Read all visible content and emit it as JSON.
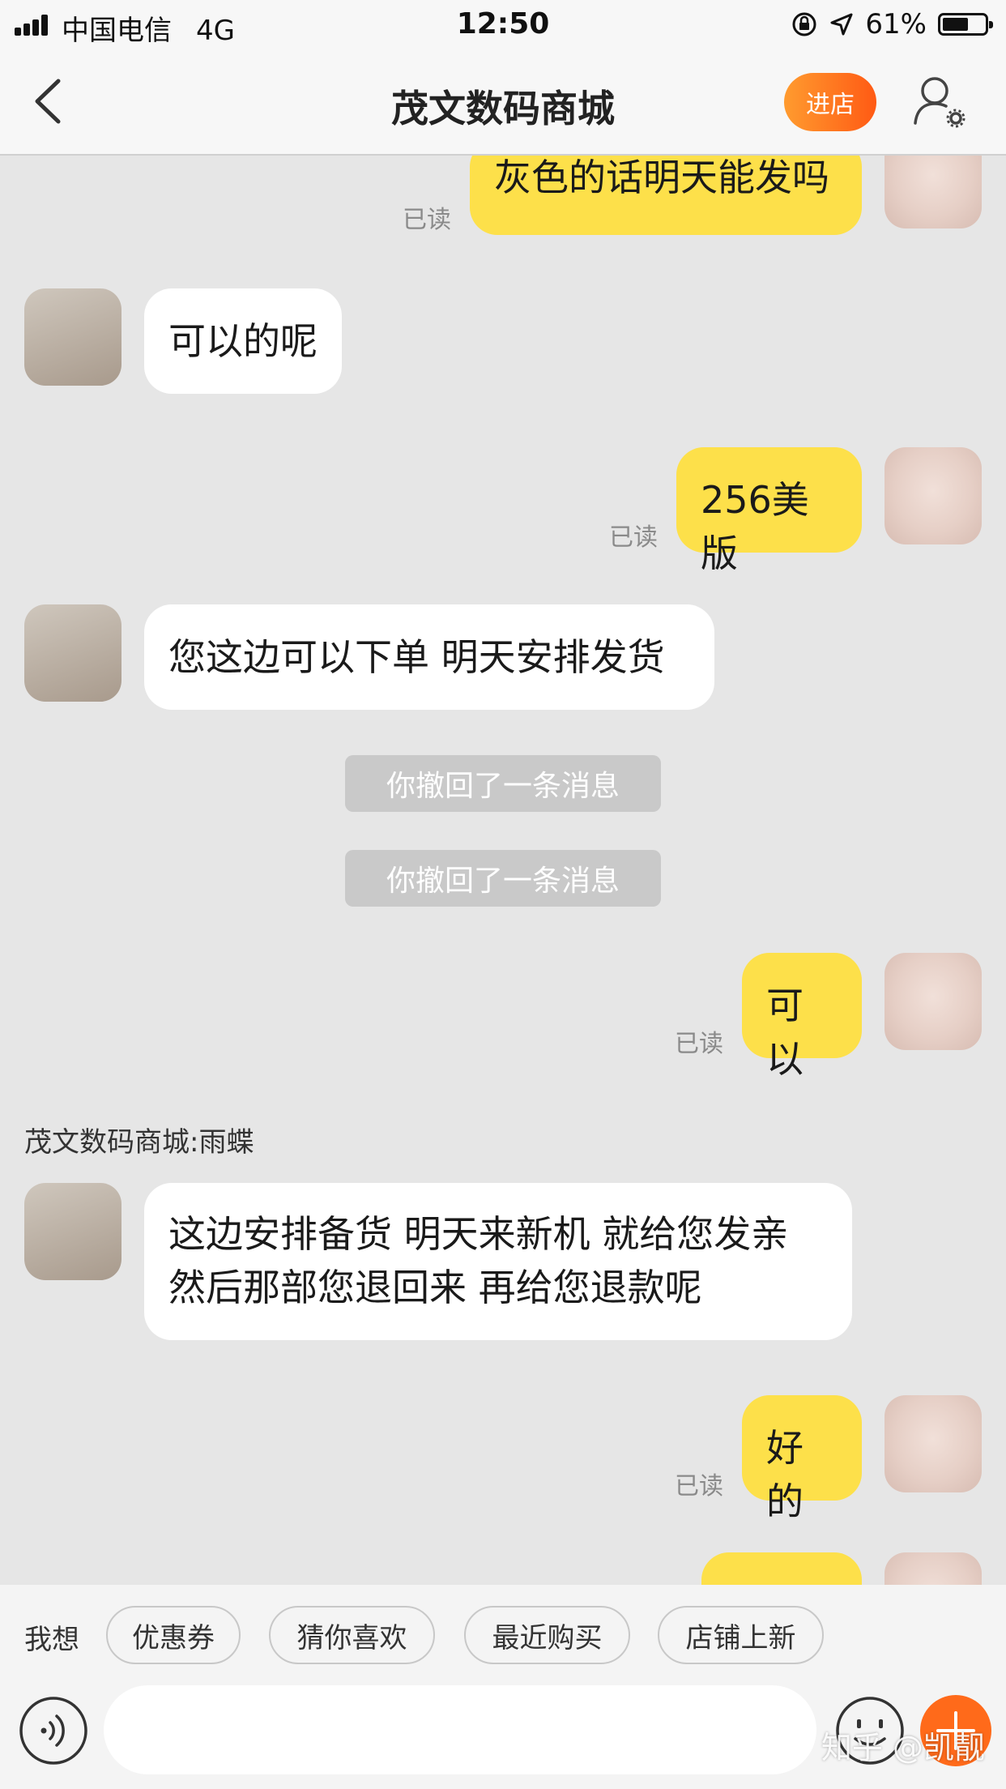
{
  "status_bar": {
    "carrier": "中国电信",
    "network": "4G",
    "time": "12:50",
    "battery": "61%",
    "battery_level": 0.61
  },
  "header": {
    "back_icon": "chevron-left-icon",
    "title": "茂文数码商城",
    "shop_button": "进店",
    "profile_icon": "user-settings-icon",
    "shop_color": "#ff6a1a"
  },
  "chat": {
    "read_label": "已读",
    "messages": [
      {
        "dir": "out",
        "text": "灰色的话明天能发吗"
      },
      {
        "dir": "in",
        "text": "可以的呢"
      },
      {
        "dir": "out",
        "text": "256美版"
      },
      {
        "dir": "in",
        "text": "您这边可以下单  明天安排发货"
      },
      {
        "dir": "system",
        "text": "你撤回了一条消息"
      },
      {
        "dir": "system",
        "text": "你撤回了一条消息"
      },
      {
        "dir": "out",
        "text": "可以"
      },
      {
        "dir": "in",
        "sender": "茂文数码商城:雨蝶",
        "text": "这边安排备货  明天来新机  就给您发亲\n然后那部您退回来  再给您退款呢"
      },
      {
        "dir": "out",
        "text": "好的"
      }
    ],
    "out_bubble_color": "#fde04a",
    "in_bubble_color": "#ffffff"
  },
  "quick_bar": {
    "label": "我想",
    "chips": [
      "优惠券",
      "猜你喜欢",
      "最近购买",
      "店铺上新"
    ]
  },
  "input_bar": {
    "voice_icon": "voice-icon",
    "emoji_icon": "emoji-icon",
    "plus_icon": "plus-icon"
  },
  "watermark": "知乎 @凯靓"
}
